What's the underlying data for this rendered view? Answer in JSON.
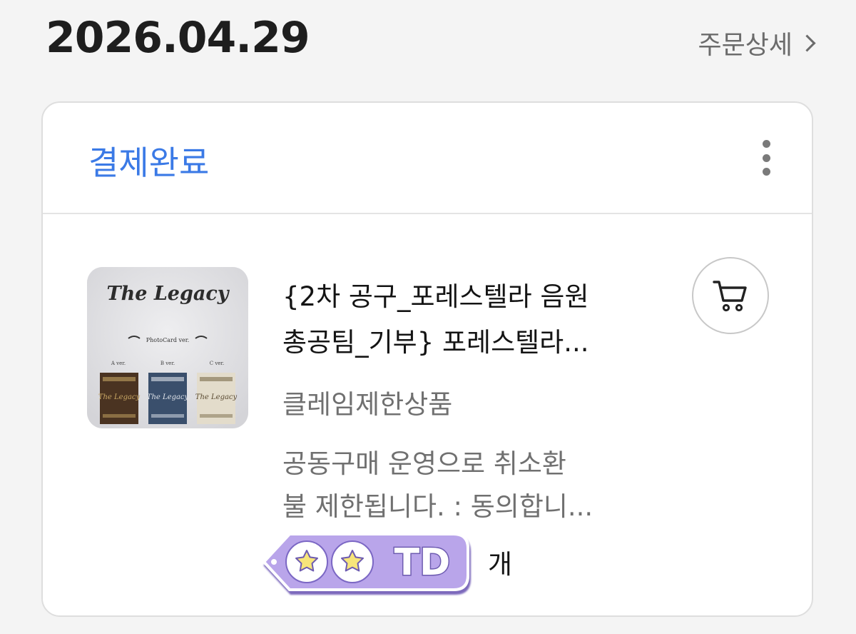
{
  "header": {
    "date": "2026.04.29",
    "order_detail_label": "주문상세"
  },
  "order": {
    "status": "결제완료",
    "product": {
      "title_line1": "{2차 공구_포레스텔라 음원",
      "title_line2": "총공팀_기부} 포레스텔라...",
      "thumbnail": {
        "logo_text": "The Legacy",
        "subtitle_text": "PhotoCard ver.",
        "versions": [
          "A ver.",
          "B ver.",
          "C ver."
        ]
      },
      "restriction_label": "클레임제한상품",
      "notice_line1": "공동구매 운영으로 취소환",
      "notice_line2": "불 제한됩니다. : 동의합니...",
      "quantity_sticker_text": "TD",
      "quantity_unit": "개"
    }
  },
  "colors": {
    "status_blue": "#3b7ae6",
    "sticker_purple": "#b9a5ea",
    "star_yellow": "#f7e57a"
  },
  "icons": {
    "cart": "cart-icon",
    "more": "more-vertical-icon",
    "chevron": "chevron-right-icon"
  }
}
